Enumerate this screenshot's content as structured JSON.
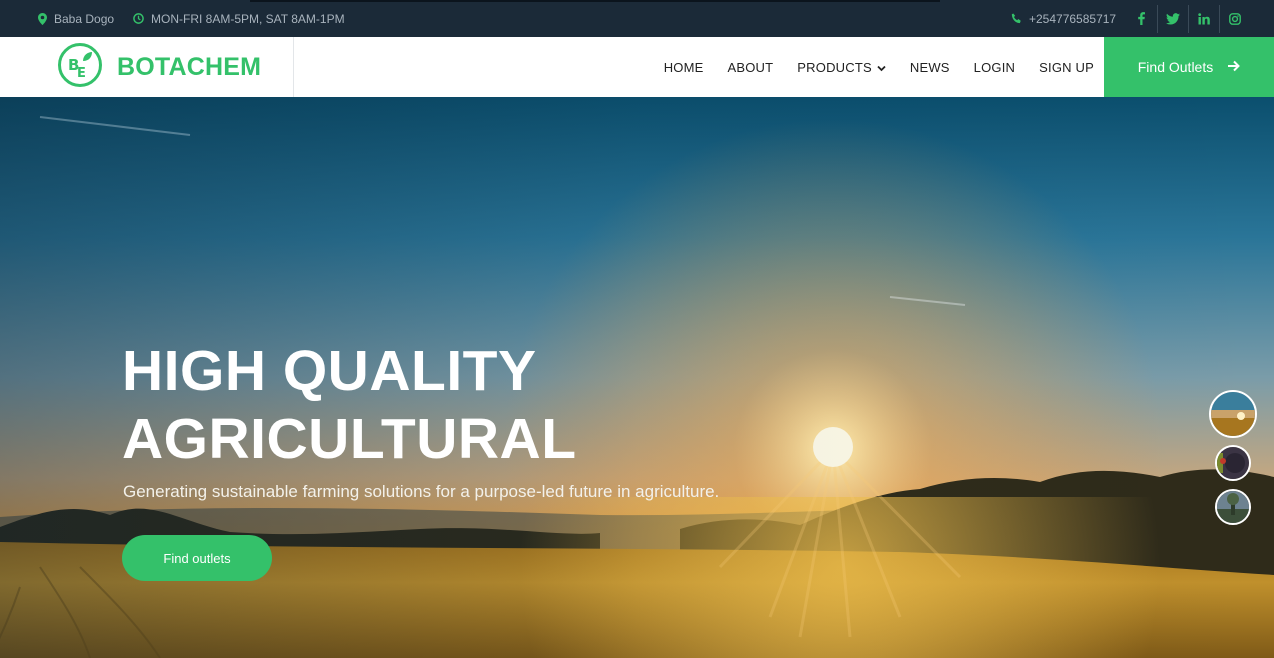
{
  "topbar": {
    "location": "Baba Dogo",
    "location_icon": "map-pin-icon",
    "hours": "MON-FRI 8AM-5PM, SAT 8AM-1PM",
    "hours_icon": "clock-icon",
    "phone": "+254776585717",
    "phone_icon": "phone-icon",
    "social": [
      "facebook-icon",
      "twitter-icon",
      "linkedin-icon",
      "instagram-icon"
    ]
  },
  "brand": {
    "name": "BOTACHEM",
    "logo_letters": "BE",
    "color": "#34c16a"
  },
  "nav": {
    "items": [
      "HOME",
      "ABOUT",
      "PRODUCTS",
      "NEWS",
      "LOGIN",
      "SIGN UP"
    ],
    "products_icon": "chevron-down-icon"
  },
  "cta": {
    "label": "Find Outlets",
    "icon": "arrow-right-icon"
  },
  "hero": {
    "title_line1": "HIGH QUALITY",
    "title_line2": "AGRICULTURAL",
    "subtitle": "Generating sustainable farming solutions for a purpose-led future in agriculture.",
    "button_label": "Find outlets"
  },
  "slider": {
    "slides": 3,
    "active_slide": 1
  }
}
